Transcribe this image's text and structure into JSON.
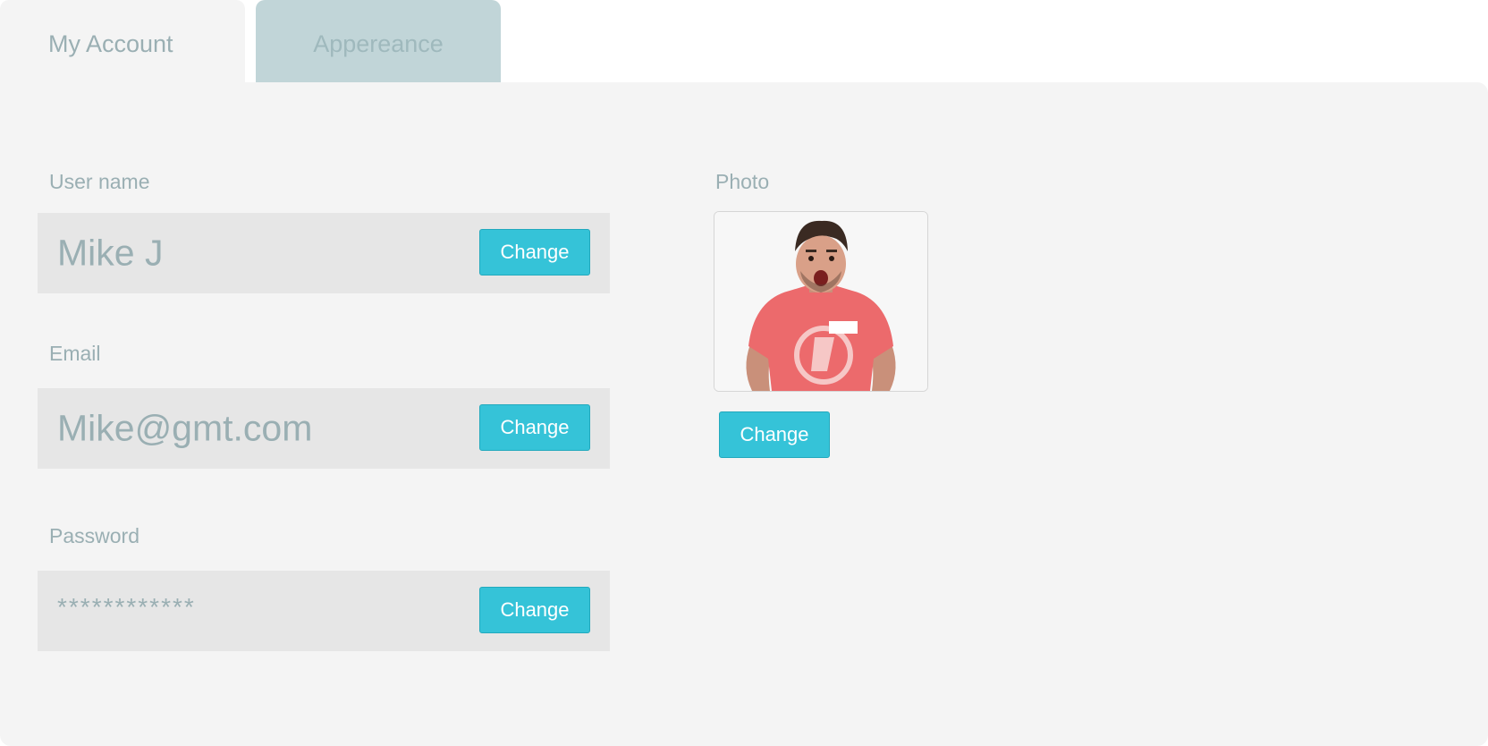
{
  "tabs": [
    {
      "label": "My Account",
      "active": true
    },
    {
      "label": "Appereance",
      "active": false
    }
  ],
  "fields": {
    "username": {
      "label": "User name",
      "value": "Mike J",
      "button": "Change"
    },
    "email": {
      "label": "Email",
      "value": "Mike@gmt.com",
      "button": "Change"
    },
    "password": {
      "label": "Password",
      "value": "************",
      "button": "Change"
    }
  },
  "photo": {
    "label": "Photo",
    "button": "Change"
  },
  "colors": {
    "accent": "#35c3d8",
    "panel": "#f4f4f4",
    "field": "#e6e6e6",
    "text": "#9aafb3",
    "inactive_tab": "#c1d5d8"
  }
}
